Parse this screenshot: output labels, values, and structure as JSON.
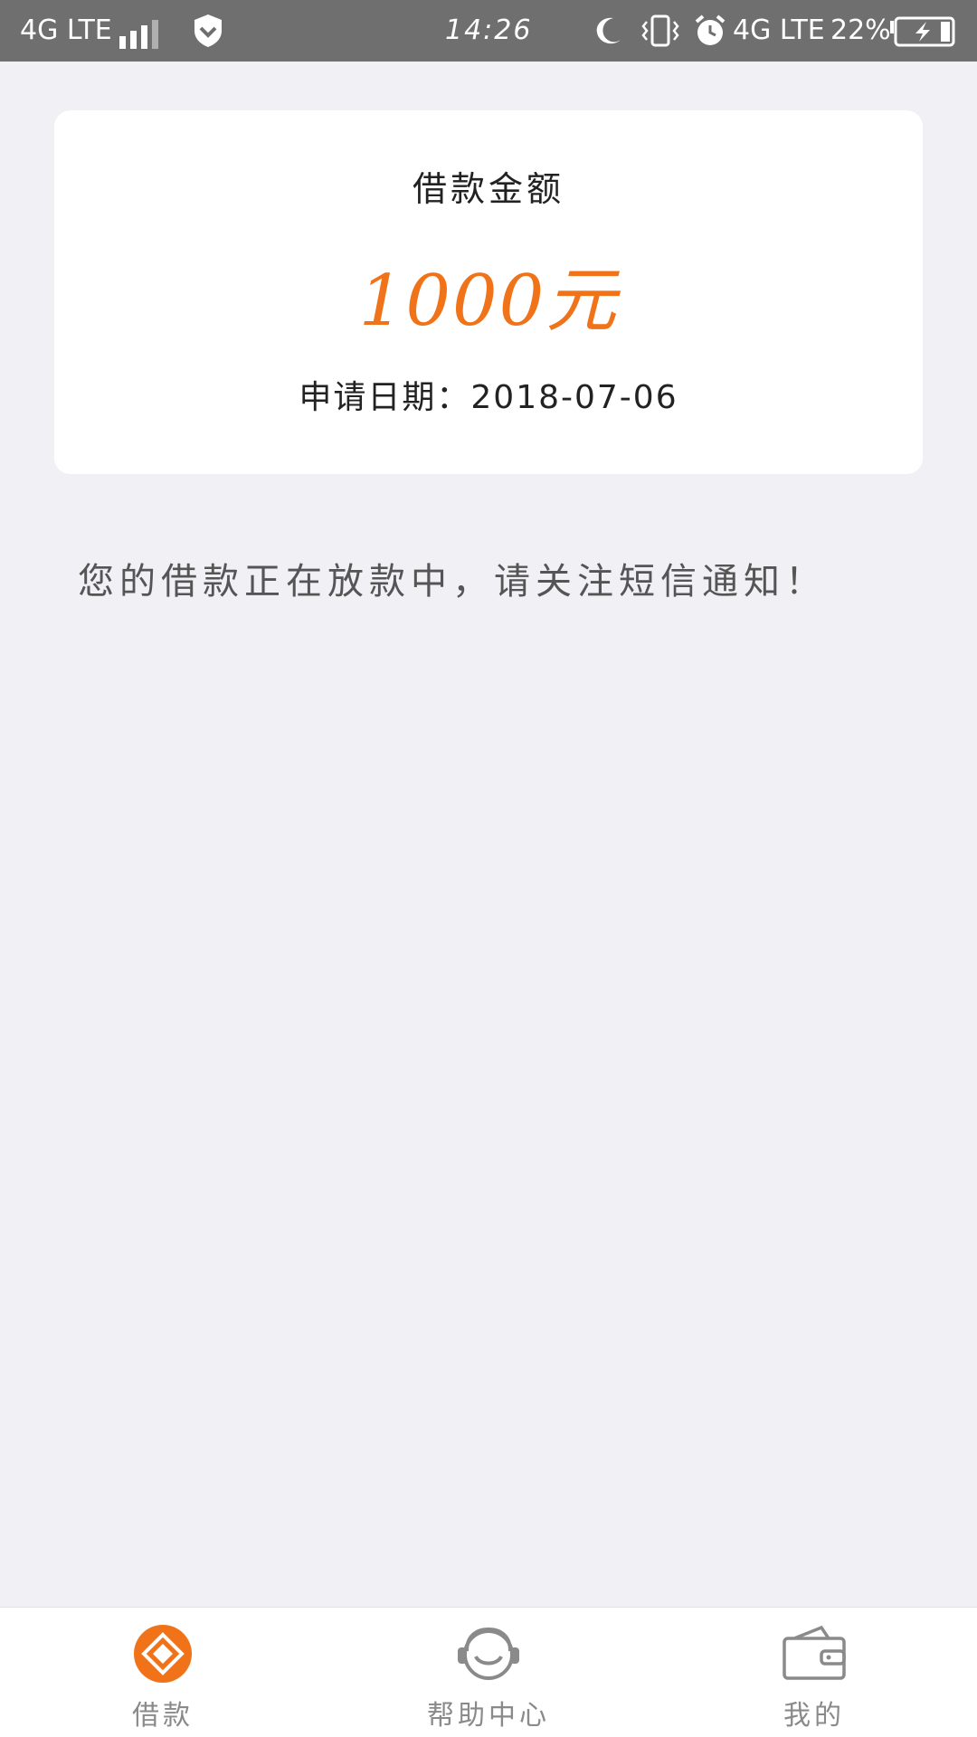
{
  "status_bar": {
    "carrier": "4G LTE",
    "time": "14:26",
    "network_right": "4G LTE",
    "battery_percent": "22%",
    "icons": [
      "signal-icon",
      "shield-icon",
      "moon-icon",
      "vibrate-icon",
      "alarm-icon",
      "battery-charging-icon"
    ]
  },
  "card": {
    "label": "借款金额",
    "amount": "1000元",
    "date": "申请日期：2018-07-06"
  },
  "notice": "您的借款正在放款中，请关注短信通知！",
  "colors": {
    "accent": "#f0731a",
    "status_bar": "#6f6f6f",
    "background": "#f1f1f5",
    "nav_inactive": "#8a8a8a"
  },
  "bottom_nav": {
    "items": [
      {
        "label": "借款",
        "icon": "loan-diamond-icon",
        "active": true
      },
      {
        "label": "帮助中心",
        "icon": "headset-icon",
        "active": false
      },
      {
        "label": "我的",
        "icon": "wallet-icon",
        "active": false
      }
    ]
  }
}
